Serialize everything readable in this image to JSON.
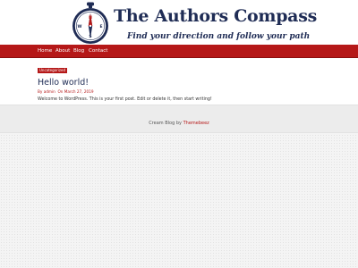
{
  "site": {
    "title": "The Authors Compass",
    "tagline": "Find your direction and follow your path",
    "compass": {
      "n": "N",
      "e": "E",
      "s": "S",
      "w": "W"
    }
  },
  "nav": {
    "items": [
      {
        "label": "Home"
      },
      {
        "label": "About"
      },
      {
        "label": "Blog"
      },
      {
        "label": "Contact"
      }
    ]
  },
  "post": {
    "category": "Uncategorized",
    "title": "Hello world!",
    "by_label": "By",
    "author": "admin",
    "on_label": "On",
    "date": "March 27, 2019",
    "excerpt": "Welcome to WordPress. This is your first post. Edit or delete it, then start writing!"
  },
  "footer": {
    "credit_text": "Cream Blog by",
    "theme_author": "Themebeez"
  },
  "colors": {
    "brand_red": "#b51818",
    "brand_navy": "#1f2c55",
    "page_bg": "#f4f4f4"
  }
}
